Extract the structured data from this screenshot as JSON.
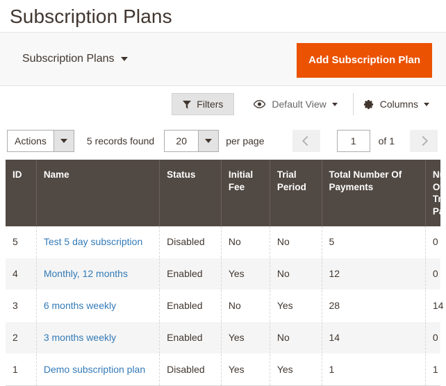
{
  "header": {
    "title": "Subscription Plans"
  },
  "page_actions": {
    "switcher_label": "Subscription Plans",
    "switcher_icon": "chevron-down-icon",
    "add_button_label": "Add Subscription Plan",
    "accent_color": "#eb5202"
  },
  "toolbar": {
    "filters_label": "Filters",
    "filters_icon": "funnel-icon",
    "view_icon": "eye-icon",
    "view_label": "Default View",
    "columns_icon": "gear-icon",
    "columns_label": "Columns"
  },
  "actionbar": {
    "actions_label": "Actions",
    "records_found": "5 records found",
    "per_page_value": "20",
    "per_page_label": "per page",
    "prev_icon": "chevron-left-icon",
    "next_icon": "chevron-right-icon",
    "page_value": "1",
    "page_of": "of 1"
  },
  "grid": {
    "columns": [
      "ID",
      "Name",
      "Status",
      "Initial Fee",
      "Trial Period",
      "Total Number Of Payments",
      "Number Of Trial Payments"
    ],
    "rows": [
      {
        "id": "5",
        "name": "Test 5 day subscription",
        "status": "Disabled",
        "initial_fee": "No",
        "trial_period": "No",
        "total_payments": "5",
        "trial_payments": "0"
      },
      {
        "id": "4",
        "name": "Monthly, 12 months",
        "status": "Enabled",
        "initial_fee": "Yes",
        "trial_period": "No",
        "total_payments": "12",
        "trial_payments": "0"
      },
      {
        "id": "3",
        "name": "6 months weekly",
        "status": "Enabled",
        "initial_fee": "No",
        "trial_period": "Yes",
        "total_payments": "28",
        "trial_payments": "14"
      },
      {
        "id": "2",
        "name": "3 months weekly",
        "status": "Enabled",
        "initial_fee": "Yes",
        "trial_period": "No",
        "total_payments": "14",
        "trial_payments": "0"
      },
      {
        "id": "1",
        "name": "Demo subscription plan",
        "status": "Disabled",
        "initial_fee": "Yes",
        "trial_period": "Yes",
        "total_payments": "1",
        "trial_payments": "1"
      }
    ]
  }
}
